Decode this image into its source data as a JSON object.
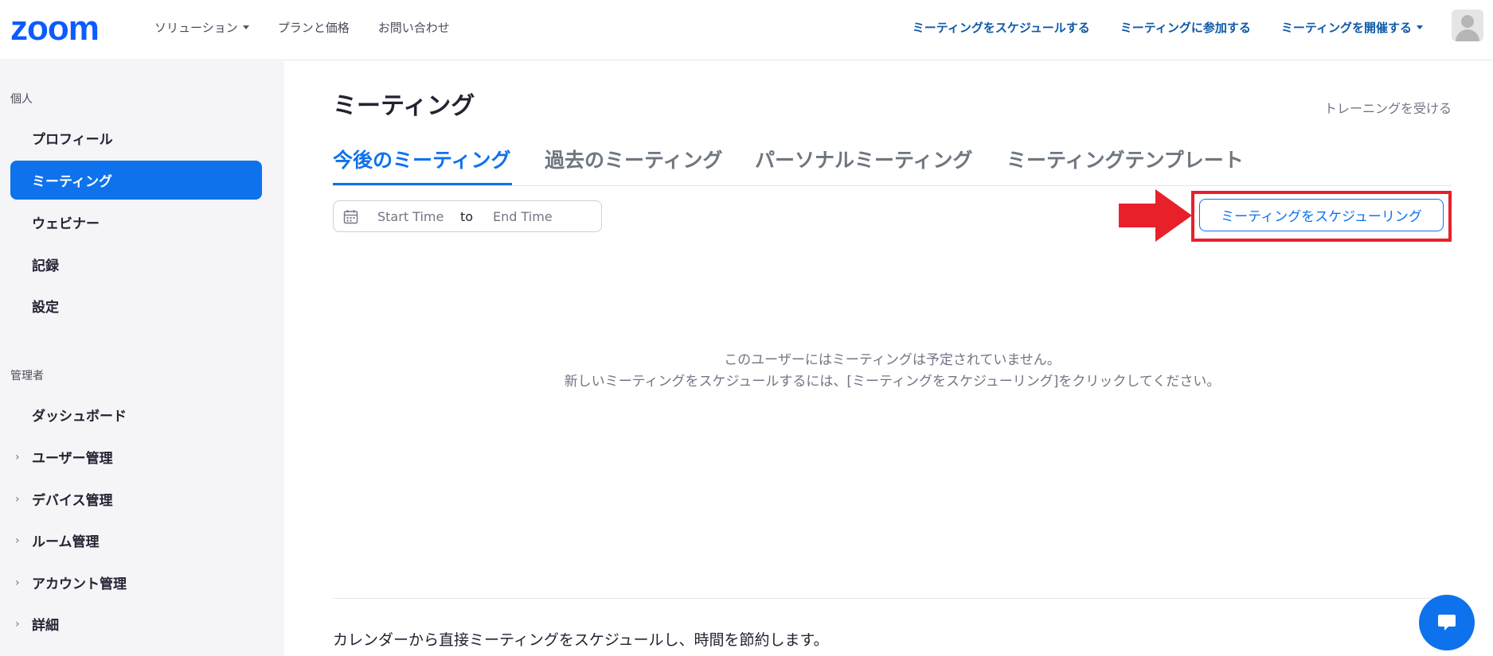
{
  "header": {
    "logo": "zoom",
    "nav": [
      "ソリューション",
      "プランと価格",
      "お問い合わせ"
    ],
    "right_nav": [
      "ミーティングをスケジュールする",
      "ミーティングに参加する",
      "ミーティングを開催する"
    ]
  },
  "sidebar": {
    "personal_heading": "個人",
    "personal_items": [
      "プロフィール",
      "ミーティング",
      "ウェビナー",
      "記録",
      "設定"
    ],
    "admin_heading": "管理者",
    "admin_items": [
      "ダッシュボード",
      "ユーザー管理",
      "デバイス管理",
      "ルーム管理",
      "アカウント管理",
      "詳細"
    ]
  },
  "main": {
    "title": "ミーティング",
    "training_link": "トレーニングを受ける",
    "tabs": [
      "今後のミーティング",
      "過去のミーティング",
      "パーソナルミーティング",
      "ミーティングテンプレート"
    ],
    "date_range": {
      "start_placeholder": "Start Time",
      "separator": "to",
      "end_placeholder": "End Time"
    },
    "schedule_button": "ミーティングをスケジューリング",
    "empty_line1": "このユーザーにはミーティングは予定されていません。",
    "empty_line2": "新しいミーティングをスケジュールするには、[ミーティングをスケジューリング]をクリックしてください。",
    "calendar_note": "カレンダーから直接ミーティングをスケジュールし、時間を節約します。"
  },
  "colors": {
    "brand": "#0b5cff",
    "accent": "#0e72ed",
    "annotation": "#e8202a"
  }
}
